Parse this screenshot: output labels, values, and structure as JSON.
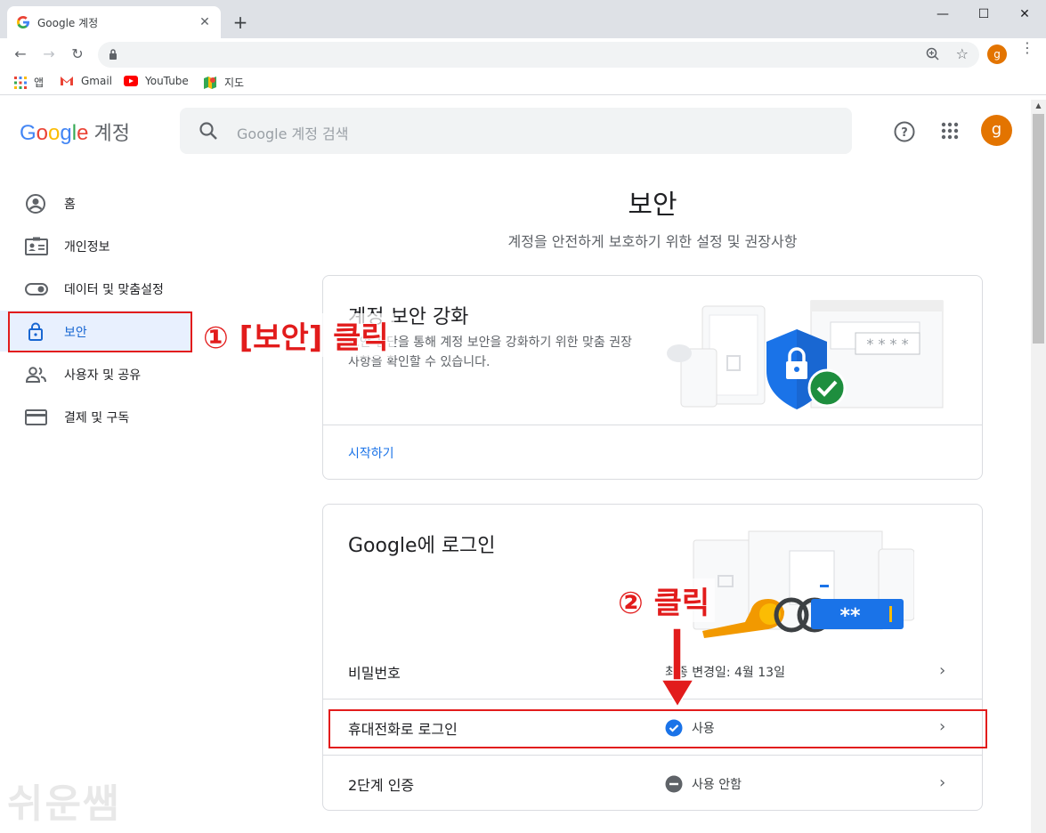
{
  "browser": {
    "tab_title": "Google 계정",
    "tab_close": "✕",
    "new_tab": "+",
    "window_controls": [
      "—",
      "☐",
      "✕"
    ],
    "back": "←",
    "forward": "→",
    "reload": "↻",
    "star": "☆",
    "profile_initial": "g",
    "menu": "⋮",
    "bookmarks": [
      {
        "label": "앱",
        "icon": "apps-grid-icon"
      },
      {
        "label": "Gmail",
        "icon": "gmail-icon"
      },
      {
        "label": "YouTube",
        "icon": "youtube-icon"
      },
      {
        "label": "지도",
        "icon": "maps-icon"
      }
    ]
  },
  "header": {
    "logo_word": "Google",
    "logo_suffix": "계정",
    "search_placeholder": "Google 계정 검색",
    "avatar_initial": "g"
  },
  "sidebar": {
    "items": [
      {
        "label": "홈",
        "icon": "account-circle-icon"
      },
      {
        "label": "개인정보",
        "icon": "id-card-icon"
      },
      {
        "label": "데이터 및 맞춤설정",
        "icon": "toggle-icon"
      },
      {
        "label": "보안",
        "icon": "lock-icon",
        "active": true
      },
      {
        "label": "사용자 및 공유",
        "icon": "people-icon"
      },
      {
        "label": "결제 및 구독",
        "icon": "credit-card-icon"
      }
    ]
  },
  "main": {
    "title": "보안",
    "subtitle": "계정을 안전하게 보호하기 위한 설정 및 권장사항",
    "card1": {
      "title": "계정 보안 강화",
      "description": "보안 진단을 통해 계정 보안을 강화하기 위한 맞춤 권장사항을 확인할 수 있습니다.",
      "link": "시작하기"
    },
    "card2": {
      "title": "Google에 로그인",
      "rows": [
        {
          "label": "비밀번호",
          "value": "최종 변경일: 4월 13일",
          "status": "none"
        },
        {
          "label": "휴대전화로 로그인",
          "value": "사용",
          "status": "on"
        },
        {
          "label": "2단계 인증",
          "value": "사용 안함",
          "status": "off"
        }
      ],
      "chevron": "›"
    }
  },
  "annotations": {
    "step1": "① [보안] 클릭",
    "step2": "② 클릭",
    "watermark": "쉬운쌤"
  },
  "colors": {
    "accent": "#1a73e8",
    "annotation_red": "#e21c1c",
    "avatar": "#e37400"
  }
}
